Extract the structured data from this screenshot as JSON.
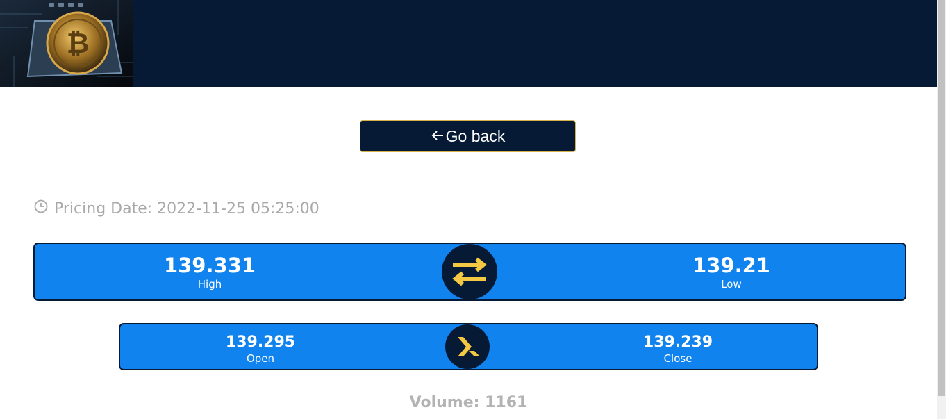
{
  "header": {
    "logo_icon": "bitcoin-image"
  },
  "back_button": {
    "label": "Go back",
    "icon": "arrow-left-icon"
  },
  "pricing": {
    "label": "Pricing Date: 2022-11-25 05:25:00",
    "icon": "clock-icon"
  },
  "high_low": {
    "high_value": "139.331",
    "high_label": "High",
    "low_value": "139.21",
    "low_label": "Low",
    "icon": "swap-arrows-icon"
  },
  "open_close": {
    "open_value": "139.295",
    "open_label": "Open",
    "close_value": "139.239",
    "close_label": "Close",
    "icon": "chevron-right-icon"
  },
  "volume": {
    "text": "Volume: 1161"
  },
  "colors": {
    "navy": "#061a35",
    "blue": "#1183ee",
    "gold": "#f5c843",
    "gray": "#a9a9a9"
  }
}
